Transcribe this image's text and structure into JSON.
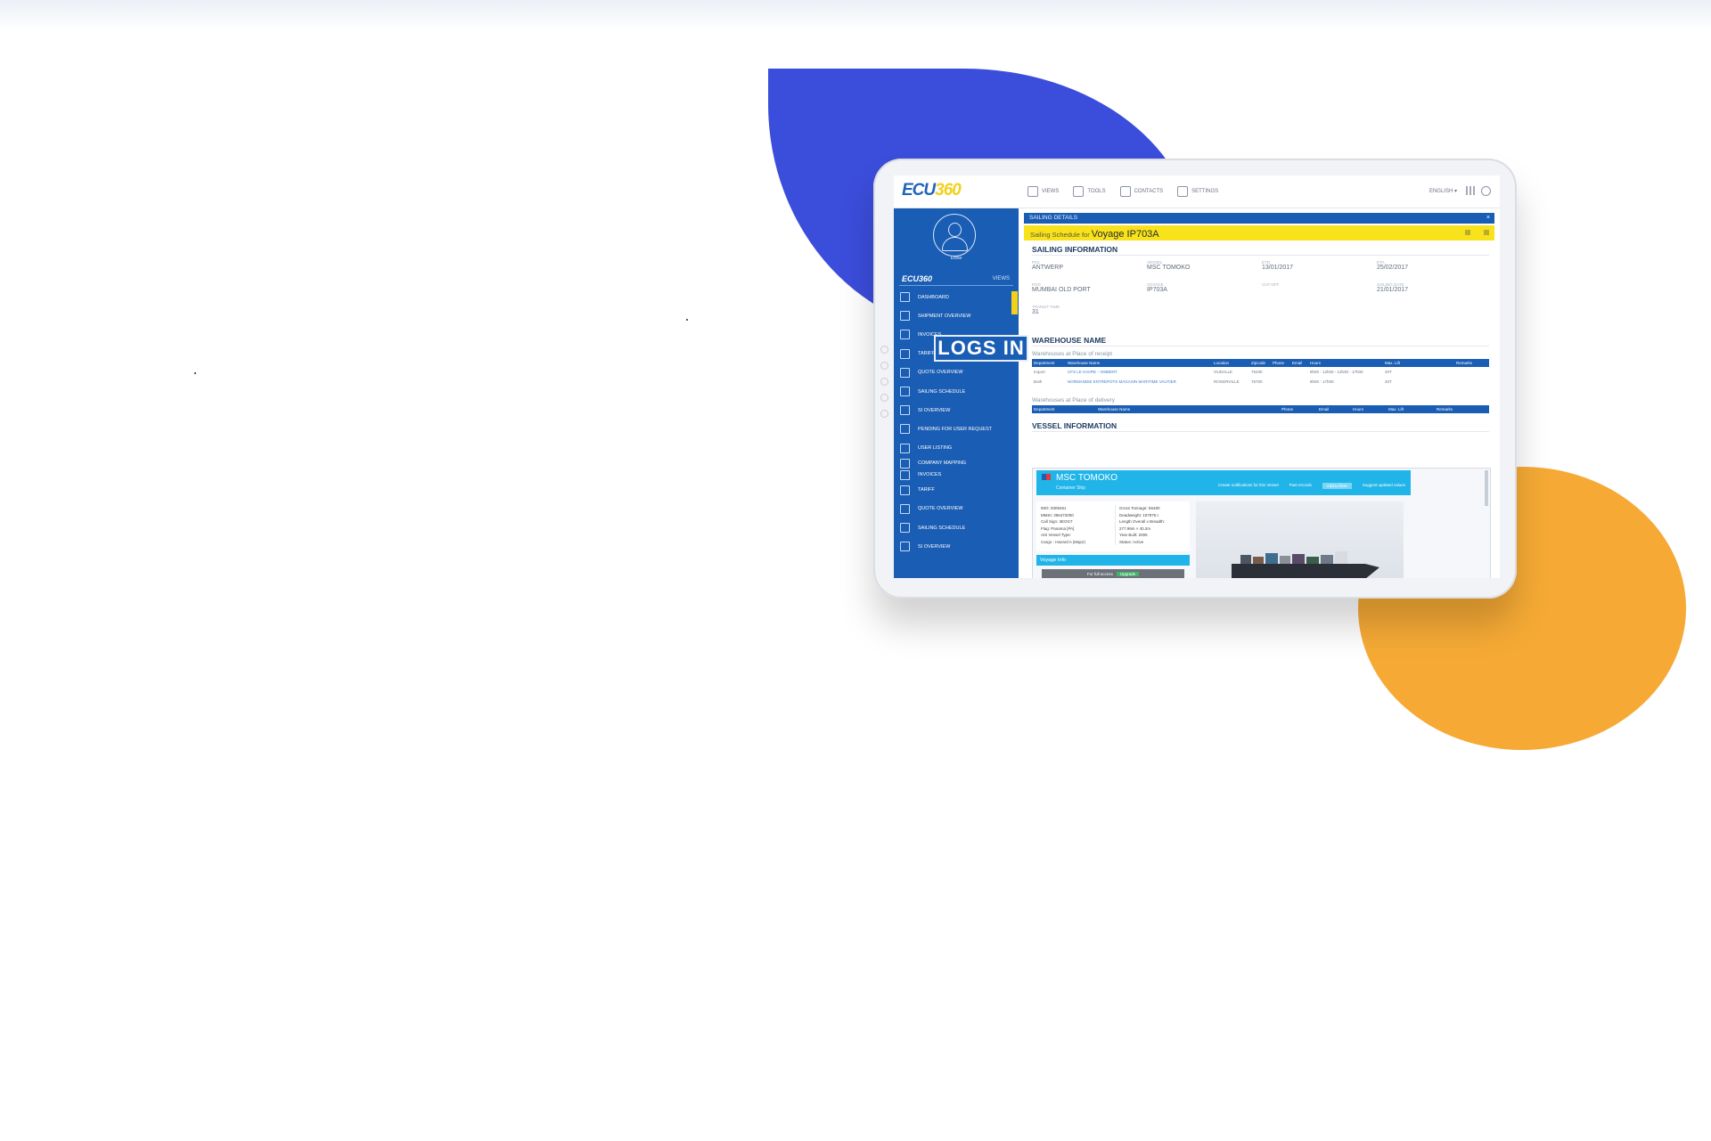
{
  "colors": {
    "blob_blue": "#3b4ddb",
    "blob_orange": "#f6aa35",
    "app_blue": "#1a5db4",
    "accent_yellow": "#f7e21c",
    "vessel_cyan": "#21b4e8"
  },
  "app": {
    "logo_part1": "ECU",
    "logo_part2": "360",
    "nav": [
      "VIEWS",
      "TOOLS",
      "CONTACTS",
      "SETTINGS"
    ],
    "language": "ENGLISH ▾"
  },
  "sidebar": {
    "user": "Eddie",
    "brand": "ECU360",
    "views_label": "VIEWS",
    "items": [
      "DASHBOARD",
      "SHIPMENT OVERVIEW",
      "INVOICES",
      "TARIFF",
      "QUOTE OVERVIEW",
      "SAILING SCHEDULE",
      "SI OVERVIEW",
      "PENDING FOR USER REQUEST",
      "USER LISTING",
      "COMPANY MAPPING",
      "INVOICES",
      "TARIFF",
      "QUOTE OVERVIEW",
      "SAILING SCHEDULE",
      "SI OVERVIEW"
    ]
  },
  "panel": {
    "header": "SAILING DETAILS",
    "close": "×",
    "schedule_prefix": "Sailing Schedule for ",
    "voyage": "Voyage IP703A"
  },
  "sailing": {
    "title": "SAILING INFORMATION",
    "fields": [
      {
        "label": "POL",
        "value": "ANTWERP"
      },
      {
        "label": "VESSEL",
        "value": "MSC TOMOKO"
      },
      {
        "label": "ETD",
        "value": "13/01/2017"
      },
      {
        "label": "ETA",
        "value": "25/02/2017"
      },
      {
        "label": "POD",
        "value": "MUMBAI OLD PORT"
      },
      {
        "label": "VOYAGE",
        "value": "IP703A"
      },
      {
        "label": "CUT-OFF",
        "value": ""
      },
      {
        "label": "SAILING DATE",
        "value": "21/01/2017"
      },
      {
        "label": "TRANSIT TIME",
        "value": "31"
      }
    ]
  },
  "warehouse": {
    "title": "WAREHOUSE NAME",
    "receipt_label": "Warehouses at Place of receipt",
    "delivery_label": "Warehouses at Place of delivery",
    "columns": [
      "Department",
      "Warehouse Name",
      "Location",
      "Zipcode",
      "Phone",
      "Email",
      "Hours",
      "Max. Lift",
      "Remarks"
    ],
    "rows": [
      {
        "dept": "Import",
        "name": "CFS LE HAVRE - VIMBERT",
        "location": "OUDALLE",
        "zip": "76430",
        "hours": "8h00 - 12h00 - 13h30 - 17h00",
        "lift": "20T"
      },
      {
        "dept": "Both",
        "name": "NORMANDIE ENTREPOTS MAGASIN MARITIME VAUTIER",
        "location": "ROGERVILLE",
        "zip": "76700",
        "hours": "8h00 - 17h00",
        "lift": "20T"
      }
    ],
    "delivery_columns": [
      "Department",
      "Warehouse Name",
      "Phone",
      "Email",
      "Hours",
      "Max. Lift",
      "Remarks"
    ]
  },
  "vessel": {
    "title": "VESSEL INFORMATION",
    "name": "MSC TOMOKO",
    "type": "Container Ship",
    "actions": [
      "Create notifications for this Vessel",
      "Past records",
      "Add to fleet",
      "Suggest updated values"
    ],
    "details_left": [
      "IMO: 9309461",
      "MMSI: 356472000",
      "Call Sign: 3EOG7",
      "Flag: Panama [PA]",
      "AIS Vessel Type:",
      "Cargo - Hazard A (Major)"
    ],
    "details_right": [
      "Gross Tonnage: 66480",
      "Deadweight: 107975 t",
      "Length Overall x Breadth:",
      "277.99m × 40.2m",
      "Year Built: 2005",
      "Status: Active"
    ],
    "voyage_info": "Voyage Info",
    "access_text": "For full access",
    "upgrade": "Upgrade"
  },
  "overlay_stamp": "LOGS IN"
}
